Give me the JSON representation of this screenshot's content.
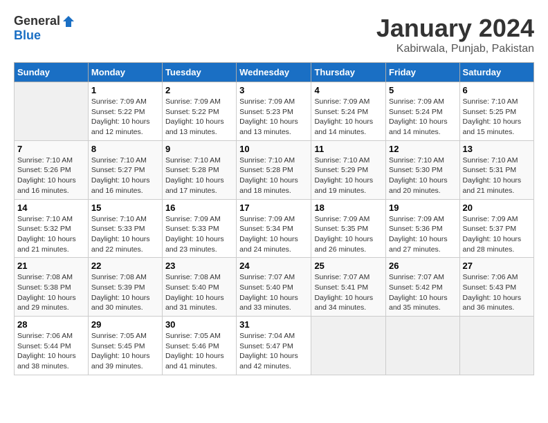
{
  "logo": {
    "general": "General",
    "blue": "Blue"
  },
  "title": "January 2024",
  "location": "Kabirwala, Punjab, Pakistan",
  "days_of_week": [
    "Sunday",
    "Monday",
    "Tuesday",
    "Wednesday",
    "Thursday",
    "Friday",
    "Saturday"
  ],
  "weeks": [
    [
      {
        "day": "",
        "sunrise": "",
        "sunset": "",
        "daylight": ""
      },
      {
        "day": "1",
        "sunrise": "Sunrise: 7:09 AM",
        "sunset": "Sunset: 5:22 PM",
        "daylight": "Daylight: 10 hours and 12 minutes."
      },
      {
        "day": "2",
        "sunrise": "Sunrise: 7:09 AM",
        "sunset": "Sunset: 5:22 PM",
        "daylight": "Daylight: 10 hours and 13 minutes."
      },
      {
        "day": "3",
        "sunrise": "Sunrise: 7:09 AM",
        "sunset": "Sunset: 5:23 PM",
        "daylight": "Daylight: 10 hours and 13 minutes."
      },
      {
        "day": "4",
        "sunrise": "Sunrise: 7:09 AM",
        "sunset": "Sunset: 5:24 PM",
        "daylight": "Daylight: 10 hours and 14 minutes."
      },
      {
        "day": "5",
        "sunrise": "Sunrise: 7:09 AM",
        "sunset": "Sunset: 5:24 PM",
        "daylight": "Daylight: 10 hours and 14 minutes."
      },
      {
        "day": "6",
        "sunrise": "Sunrise: 7:10 AM",
        "sunset": "Sunset: 5:25 PM",
        "daylight": "Daylight: 10 hours and 15 minutes."
      }
    ],
    [
      {
        "day": "7",
        "sunrise": "Sunrise: 7:10 AM",
        "sunset": "Sunset: 5:26 PM",
        "daylight": "Daylight: 10 hours and 16 minutes."
      },
      {
        "day": "8",
        "sunrise": "Sunrise: 7:10 AM",
        "sunset": "Sunset: 5:27 PM",
        "daylight": "Daylight: 10 hours and 16 minutes."
      },
      {
        "day": "9",
        "sunrise": "Sunrise: 7:10 AM",
        "sunset": "Sunset: 5:28 PM",
        "daylight": "Daylight: 10 hours and 17 minutes."
      },
      {
        "day": "10",
        "sunrise": "Sunrise: 7:10 AM",
        "sunset": "Sunset: 5:28 PM",
        "daylight": "Daylight: 10 hours and 18 minutes."
      },
      {
        "day": "11",
        "sunrise": "Sunrise: 7:10 AM",
        "sunset": "Sunset: 5:29 PM",
        "daylight": "Daylight: 10 hours and 19 minutes."
      },
      {
        "day": "12",
        "sunrise": "Sunrise: 7:10 AM",
        "sunset": "Sunset: 5:30 PM",
        "daylight": "Daylight: 10 hours and 20 minutes."
      },
      {
        "day": "13",
        "sunrise": "Sunrise: 7:10 AM",
        "sunset": "Sunset: 5:31 PM",
        "daylight": "Daylight: 10 hours and 21 minutes."
      }
    ],
    [
      {
        "day": "14",
        "sunrise": "Sunrise: 7:10 AM",
        "sunset": "Sunset: 5:32 PM",
        "daylight": "Daylight: 10 hours and 21 minutes."
      },
      {
        "day": "15",
        "sunrise": "Sunrise: 7:10 AM",
        "sunset": "Sunset: 5:33 PM",
        "daylight": "Daylight: 10 hours and 22 minutes."
      },
      {
        "day": "16",
        "sunrise": "Sunrise: 7:09 AM",
        "sunset": "Sunset: 5:33 PM",
        "daylight": "Daylight: 10 hours and 23 minutes."
      },
      {
        "day": "17",
        "sunrise": "Sunrise: 7:09 AM",
        "sunset": "Sunset: 5:34 PM",
        "daylight": "Daylight: 10 hours and 24 minutes."
      },
      {
        "day": "18",
        "sunrise": "Sunrise: 7:09 AM",
        "sunset": "Sunset: 5:35 PM",
        "daylight": "Daylight: 10 hours and 26 minutes."
      },
      {
        "day": "19",
        "sunrise": "Sunrise: 7:09 AM",
        "sunset": "Sunset: 5:36 PM",
        "daylight": "Daylight: 10 hours and 27 minutes."
      },
      {
        "day": "20",
        "sunrise": "Sunrise: 7:09 AM",
        "sunset": "Sunset: 5:37 PM",
        "daylight": "Daylight: 10 hours and 28 minutes."
      }
    ],
    [
      {
        "day": "21",
        "sunrise": "Sunrise: 7:08 AM",
        "sunset": "Sunset: 5:38 PM",
        "daylight": "Daylight: 10 hours and 29 minutes."
      },
      {
        "day": "22",
        "sunrise": "Sunrise: 7:08 AM",
        "sunset": "Sunset: 5:39 PM",
        "daylight": "Daylight: 10 hours and 30 minutes."
      },
      {
        "day": "23",
        "sunrise": "Sunrise: 7:08 AM",
        "sunset": "Sunset: 5:40 PM",
        "daylight": "Daylight: 10 hours and 31 minutes."
      },
      {
        "day": "24",
        "sunrise": "Sunrise: 7:07 AM",
        "sunset": "Sunset: 5:40 PM",
        "daylight": "Daylight: 10 hours and 33 minutes."
      },
      {
        "day": "25",
        "sunrise": "Sunrise: 7:07 AM",
        "sunset": "Sunset: 5:41 PM",
        "daylight": "Daylight: 10 hours and 34 minutes."
      },
      {
        "day": "26",
        "sunrise": "Sunrise: 7:07 AM",
        "sunset": "Sunset: 5:42 PM",
        "daylight": "Daylight: 10 hours and 35 minutes."
      },
      {
        "day": "27",
        "sunrise": "Sunrise: 7:06 AM",
        "sunset": "Sunset: 5:43 PM",
        "daylight": "Daylight: 10 hours and 36 minutes."
      }
    ],
    [
      {
        "day": "28",
        "sunrise": "Sunrise: 7:06 AM",
        "sunset": "Sunset: 5:44 PM",
        "daylight": "Daylight: 10 hours and 38 minutes."
      },
      {
        "day": "29",
        "sunrise": "Sunrise: 7:05 AM",
        "sunset": "Sunset: 5:45 PM",
        "daylight": "Daylight: 10 hours and 39 minutes."
      },
      {
        "day": "30",
        "sunrise": "Sunrise: 7:05 AM",
        "sunset": "Sunset: 5:46 PM",
        "daylight": "Daylight: 10 hours and 41 minutes."
      },
      {
        "day": "31",
        "sunrise": "Sunrise: 7:04 AM",
        "sunset": "Sunset: 5:47 PM",
        "daylight": "Daylight: 10 hours and 42 minutes."
      },
      {
        "day": "",
        "sunrise": "",
        "sunset": "",
        "daylight": ""
      },
      {
        "day": "",
        "sunrise": "",
        "sunset": "",
        "daylight": ""
      },
      {
        "day": "",
        "sunrise": "",
        "sunset": "",
        "daylight": ""
      }
    ]
  ]
}
